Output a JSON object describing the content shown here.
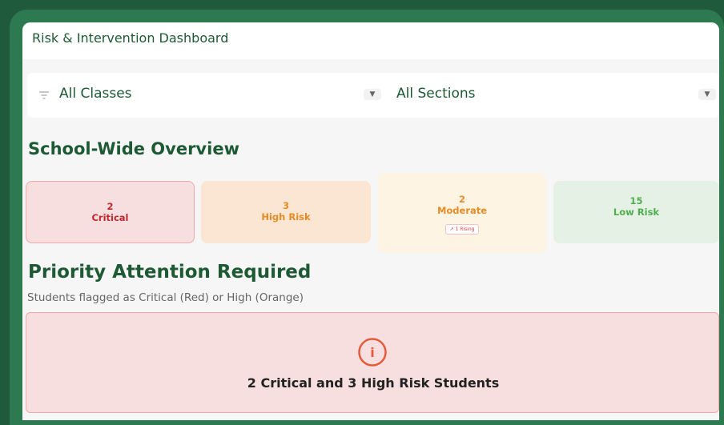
{
  "header": {
    "title": "Risk & Intervention Dashboard"
  },
  "filters": {
    "class_select": {
      "value": "All Classes"
    },
    "section_select": {
      "value": "All Sections"
    },
    "icons": {
      "filter": "filter-icon",
      "caret": "chevron-down-icon"
    }
  },
  "overview": {
    "heading": "School-Wide Overview",
    "cards": [
      {
        "count": "2",
        "label": "Critical",
        "color": "#c0282d",
        "bg": "#f7dfdf"
      },
      {
        "count": "3",
        "label": "High Risk",
        "color": "#e98b24",
        "bg": "#fbe6d3"
      },
      {
        "count": "2",
        "label": "Moderate",
        "badge": "↗ 1 Rising",
        "color": "#e98b24",
        "bg": "#fdf4e3"
      },
      {
        "count": "15",
        "label": "Low Risk",
        "color": "#4fae4f",
        "bg": "#e5f1e4"
      }
    ]
  },
  "priority": {
    "heading": "Priority Attention Required",
    "subtitle": "Students flagged as Critical (Red) or High (Orange)",
    "alert_icon": "info-icon",
    "alert_text": "2 Critical and 3 High Risk Students"
  },
  "colors": {
    "brand": "#1d5a34",
    "frame": "#2e7a50",
    "alert": "#e8593a"
  }
}
